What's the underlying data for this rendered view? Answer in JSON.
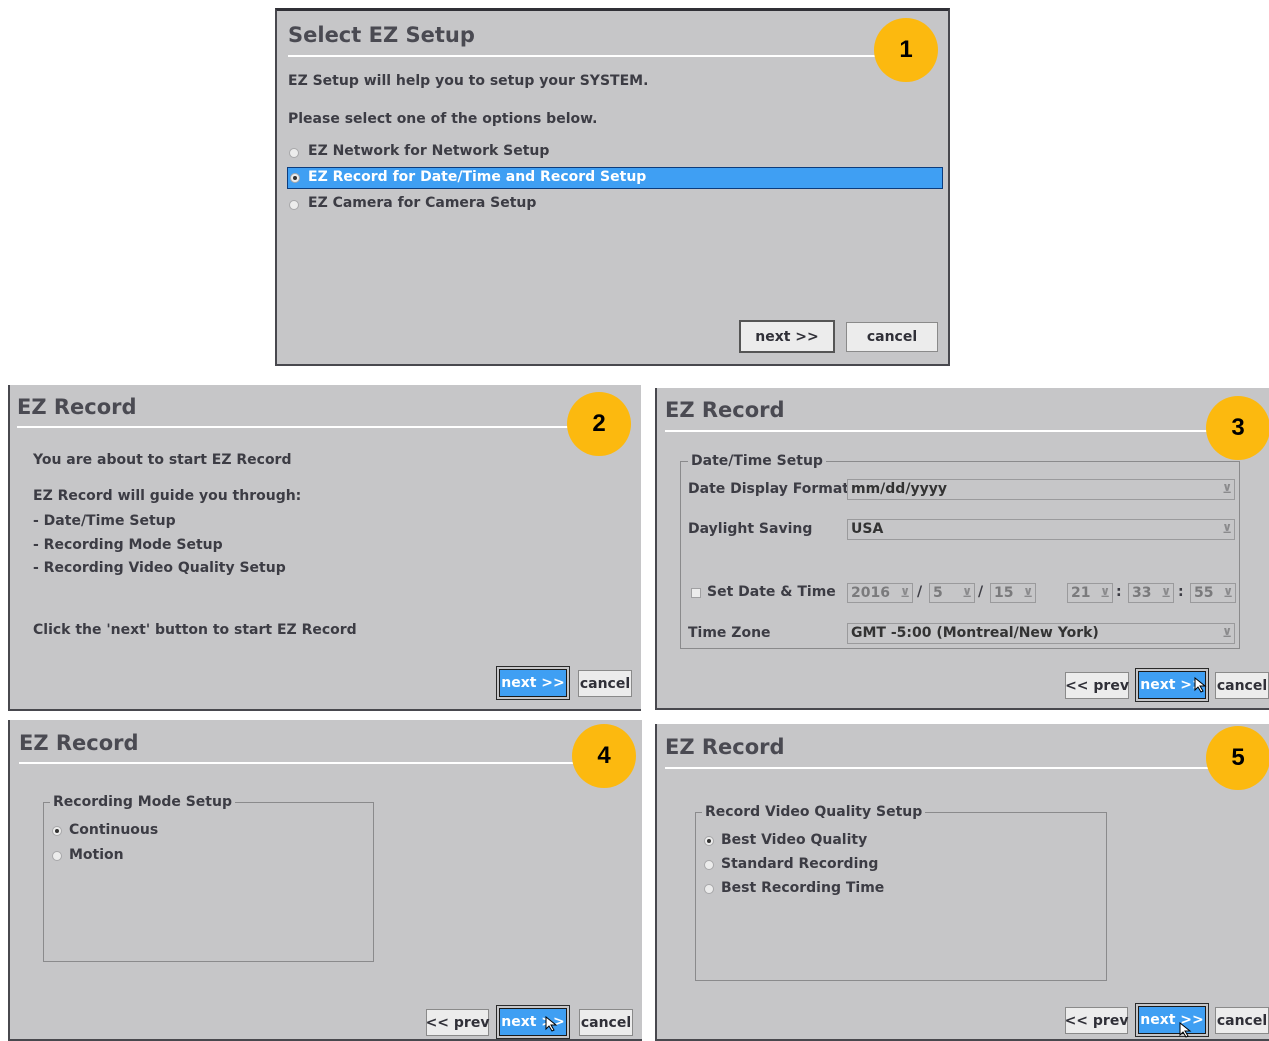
{
  "panel1": {
    "title": "Select  EZ  Setup",
    "badge": "1",
    "intro": "EZ  Setup  will  help  you  to  setup  your  SYSTEM.",
    "prompt": "Please  select  one  of  the  options  below.",
    "options": [
      {
        "label": "EZ  Network  for  Network  Setup",
        "selected": false
      },
      {
        "label": "EZ  Record  for  Date/Time  and  Record  Setup",
        "selected": true
      },
      {
        "label": "EZ  Camera  for  Camera  Setup",
        "selected": false
      }
    ],
    "next_label": "next  >>",
    "cancel_label": "cancel"
  },
  "panel2": {
    "title": "EZ  Record",
    "badge": "2",
    "line1": "You  are  about  to  start  EZ  Record",
    "line2": "EZ  Record  will  guide  you  through:",
    "items": [
      "-  Date/Time  Setup",
      "-  Recording  Mode  Setup",
      "-  Recording  Video  Quality  Setup"
    ],
    "footer": "Click  the  'next'  button  to  start  EZ  Record",
    "next_label": "next  >>",
    "cancel_label": "cancel"
  },
  "panel3": {
    "title": "EZ  Record",
    "badge": "3",
    "group_label": "Date/Time  Setup",
    "date_format_label": "Date  Display  Format",
    "date_format_value": "mm/dd/yyyy",
    "dst_label": "Daylight  Saving",
    "dst_value": "USA",
    "set_date_label": "Set  Date  &  Time",
    "year": "2016",
    "month": "5",
    "day": "15",
    "hour": "21",
    "minute": "33",
    "second": "55",
    "date_sep": "/",
    "time_sep": ":",
    "tz_label": "Time  Zone",
    "tz_value": "GMT  -5:00  (Montreal/New  York)",
    "prev_label": "<<  prev",
    "next_label": "next  >>",
    "cancel_label": "cancel"
  },
  "panel4": {
    "title": "EZ  Record",
    "badge": "4",
    "group_label": "Recording  Mode  Setup",
    "options": [
      {
        "label": "Continuous",
        "selected": true
      },
      {
        "label": "Motion",
        "selected": false
      }
    ],
    "prev_label": "<<  prev",
    "next_label": "next  >>",
    "cancel_label": "cancel"
  },
  "panel5": {
    "title": "EZ  Record",
    "badge": "5",
    "group_label": "Record  Video  Quality  Setup",
    "options": [
      {
        "label": "Best  Video  Quality",
        "selected": true
      },
      {
        "label": "Standard  Recording",
        "selected": false
      },
      {
        "label": "Best  Recording  Time",
        "selected": false
      }
    ],
    "prev_label": "<<  prev",
    "next_label": "next  >>",
    "cancel_label": "cancel"
  },
  "colors": {
    "accent_blue": "#3f9ff3",
    "badge_yellow": "#fcb90f",
    "panel_gray": "#c6c6c8"
  },
  "icons": [
    "radio-icon",
    "checkbox-icon",
    "dropdown-arrow-icon",
    "mouse-cursor-icon"
  ]
}
